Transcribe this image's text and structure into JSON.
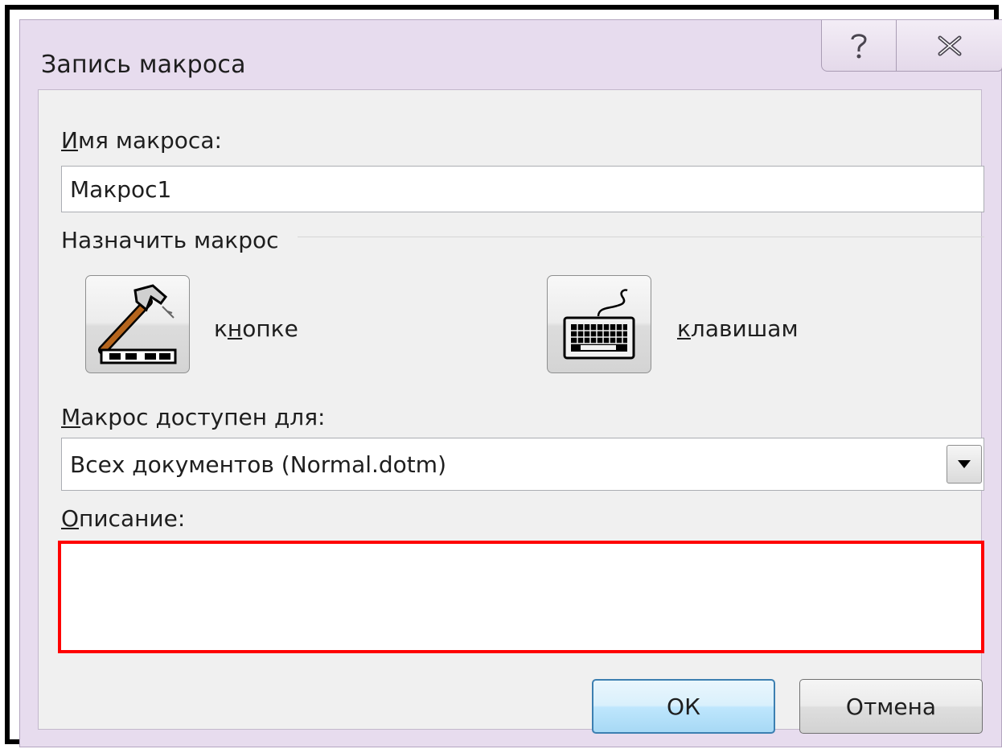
{
  "window": {
    "title": "Запись макроса",
    "help_glyph": "?",
    "close_glyph": "✕"
  },
  "macro_name": {
    "label": "Имя макроса:",
    "value": "Макрос1"
  },
  "assign": {
    "heading": "Назначить макрос",
    "button_label": "кнопке",
    "keyboard_label": "клавишам"
  },
  "available_for": {
    "label": "Макрос доступен для:",
    "selected": "Всех документов (Normal.dotm)"
  },
  "description": {
    "label": "Описание:",
    "value": "",
    "highlight_color": "#ff0000"
  },
  "buttons": {
    "ok": "ОК",
    "cancel": "Отмена"
  },
  "icons": {
    "help": "help-icon",
    "close": "close-icon",
    "hammer": "hammer-toolbar-icon",
    "keyboard": "keyboard-icon",
    "dropdown": "chevron-down-icon"
  }
}
